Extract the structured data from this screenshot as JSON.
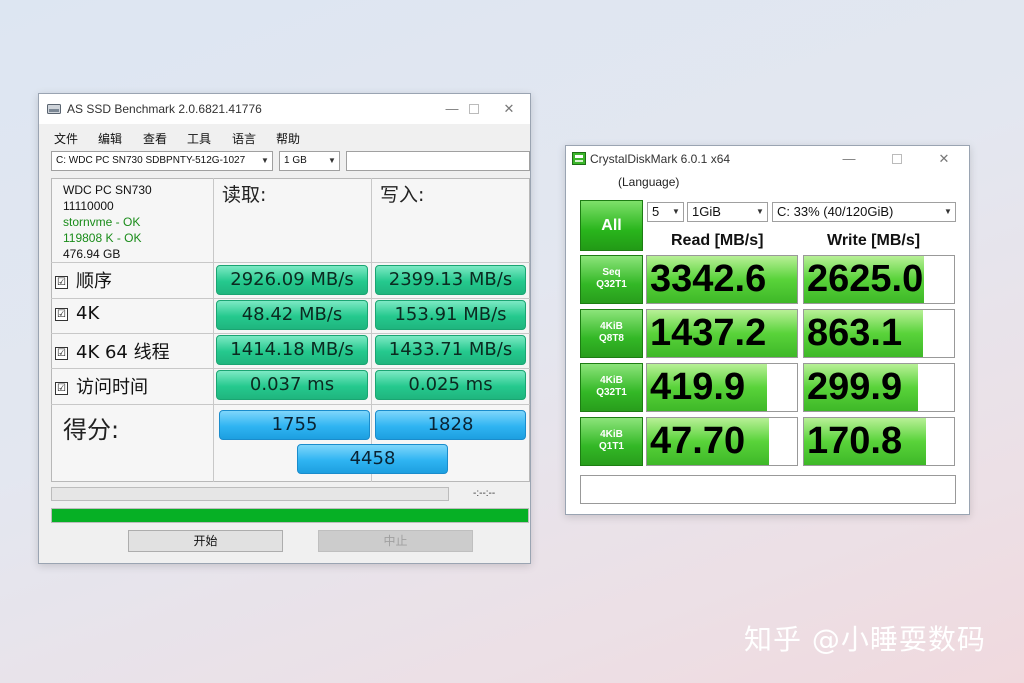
{
  "asssd": {
    "title": "AS SSD Benchmark 2.0.6821.41776",
    "menu": [
      "文件",
      "编辑",
      "查看",
      "工具",
      "语言",
      "帮助"
    ],
    "drive_select": "C: WDC PC SN730 SDBPNTY-512G-1027",
    "size_select": "1 GB",
    "device": {
      "model": "WDC PC SN730",
      "firmware": "11110000",
      "driver": "stornvme - OK",
      "alignment": "119808 K - OK",
      "capacity": "476.94 GB"
    },
    "col_read": "读取:",
    "col_write": "写入:",
    "rows": [
      {
        "label": "顺序",
        "read": "2926.09 MB/s",
        "write": "2399.13 MB/s"
      },
      {
        "label": "4K",
        "read": "48.42 MB/s",
        "write": "153.91 MB/s"
      },
      {
        "label": "4K 64 线程",
        "read": "1414.18 MB/s",
        "write": "1433.71 MB/s"
      },
      {
        "label": "访问时间",
        "read": "0.037 ms",
        "write": "0.025 ms"
      }
    ],
    "check_mark": "☑",
    "score_label": "得分:",
    "score_read": "1755",
    "score_write": "1828",
    "score_total": "4458",
    "time_display": "-:--:--",
    "progress_fraction": 1.0,
    "start_button": "开始",
    "stop_button": "中止"
  },
  "cdm": {
    "title": "CrystalDiskMark 6.0.1 x64",
    "language_menu": "(Language)",
    "all_button": "All",
    "count_select": "5",
    "size_select": "1GiB",
    "drive_select": "C: 33% (40/120GiB)",
    "read_header": "Read [MB/s]",
    "write_header": "Write [MB/s]",
    "tests": [
      {
        "line1": "Seq",
        "line2": "Q32T1",
        "read": "3342.6",
        "write": "2625.0",
        "read_fill": 1.0,
        "write_fill": 0.8
      },
      {
        "line1": "4KiB",
        "line2": "Q8T8",
        "read": "1437.2",
        "write": "863.1",
        "read_fill": 1.0,
        "write_fill": 0.79
      },
      {
        "line1": "4KiB",
        "line2": "Q32T1",
        "read": "419.9",
        "write": "299.9",
        "read_fill": 0.8,
        "write_fill": 0.76
      },
      {
        "line1": "4KiB",
        "line2": "Q1T1",
        "read": "47.70",
        "write": "170.8",
        "read_fill": 0.81,
        "write_fill": 0.81
      }
    ]
  },
  "watermark": "知乎 @小睡耍数码",
  "colors": {
    "asssd_green": "#25c98e",
    "asssd_blue": "#2fb4f2",
    "progress_green": "#06b025",
    "cdm_green": "#29b51c"
  }
}
